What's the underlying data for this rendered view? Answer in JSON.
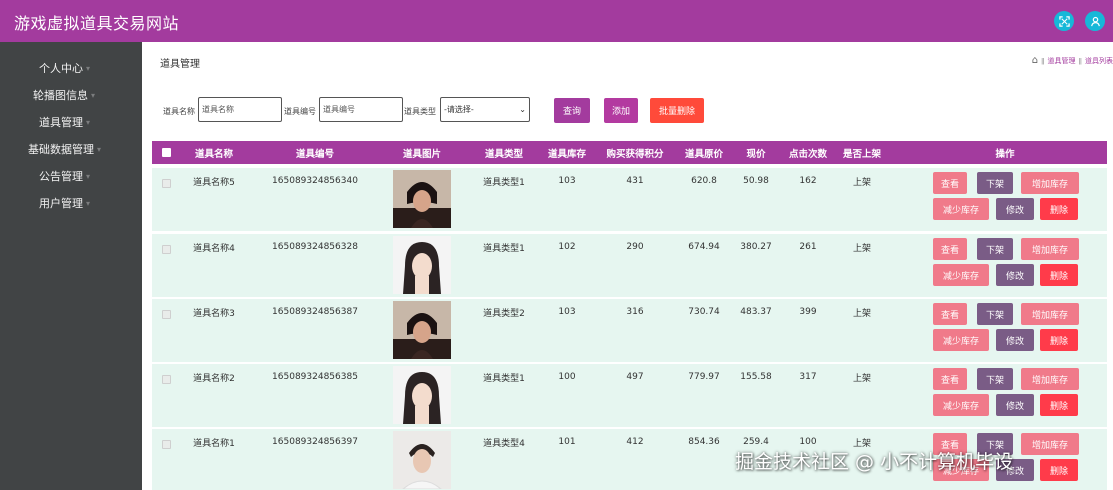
{
  "app": {
    "title": "游戏虚拟道具交易网站"
  },
  "header": {
    "icons": [
      "expand-icon",
      "user-icon"
    ]
  },
  "sidebar": {
    "items": [
      {
        "label": "个人中心"
      },
      {
        "label": "轮播图信息"
      },
      {
        "label": "道具管理"
      },
      {
        "label": "基础数据管理"
      },
      {
        "label": "公告管理"
      },
      {
        "label": "用户管理"
      }
    ]
  },
  "page": {
    "title": "道具管理"
  },
  "breadcrumb": {
    "items": [
      "道具管理",
      "道具列表"
    ]
  },
  "search": {
    "name_label": "道具名称",
    "name_placeholder": "道具名称",
    "code_label": "道具编号",
    "code_placeholder": "道具编号",
    "type_label": "道具类型",
    "type_selected": "-请选择-",
    "query_button": "查询",
    "add_button": "添加",
    "batch_delete_button": "批量删除"
  },
  "table": {
    "headers": [
      "道具名称",
      "道具编号",
      "道具图片",
      "道具类型",
      "道具库存",
      "购买获得积分",
      "道具原价",
      "现价",
      "点击次数",
      "是否上架",
      "操作"
    ],
    "rows": [
      {
        "name": "道具名称5",
        "code": "165089324856340",
        "type": "道具类型1",
        "stock": "103",
        "points": "431",
        "orig": "620.8",
        "price": "50.98",
        "clicks": "162",
        "status": "上架",
        "img": "dark"
      },
      {
        "name": "道具名称4",
        "code": "165089324856328",
        "type": "道具类型1",
        "stock": "102",
        "points": "290",
        "orig": "674.94",
        "price": "380.27",
        "clicks": "261",
        "status": "上架",
        "img": "light"
      },
      {
        "name": "道具名称3",
        "code": "165089324856387",
        "type": "道具类型2",
        "stock": "103",
        "points": "316",
        "orig": "730.74",
        "price": "483.37",
        "clicks": "399",
        "status": "上架",
        "img": "dark"
      },
      {
        "name": "道具名称2",
        "code": "165089324856385",
        "type": "道具类型1",
        "stock": "100",
        "points": "497",
        "orig": "779.97",
        "price": "155.58",
        "clicks": "317",
        "status": "上架",
        "img": "light"
      },
      {
        "name": "道具名称1",
        "code": "165089324856397",
        "type": "道具类型4",
        "stock": "101",
        "points": "412",
        "orig": "854.36",
        "price": "259.4",
        "clicks": "100",
        "status": "上架",
        "img": "man"
      }
    ],
    "actions": {
      "view": "查看",
      "offshelf": "下架",
      "add_stock": "增加库存",
      "reduce_stock": "减少库存",
      "edit": "修改",
      "delete": "删除"
    }
  },
  "watermark": "掘金技术社区 @ 小不计算机毕设",
  "colors": {
    "brand": "#a33b9e",
    "sidebar": "#414445",
    "accent_cyan": "#16b8d8",
    "btn_add": "#e85890",
    "btn_delete": "#ff4a3a",
    "action_pink": "#f07a8a",
    "action_purple": "#7a5c86",
    "action_red": "#ff3b4a",
    "row_bg": "#e6f6f0"
  }
}
